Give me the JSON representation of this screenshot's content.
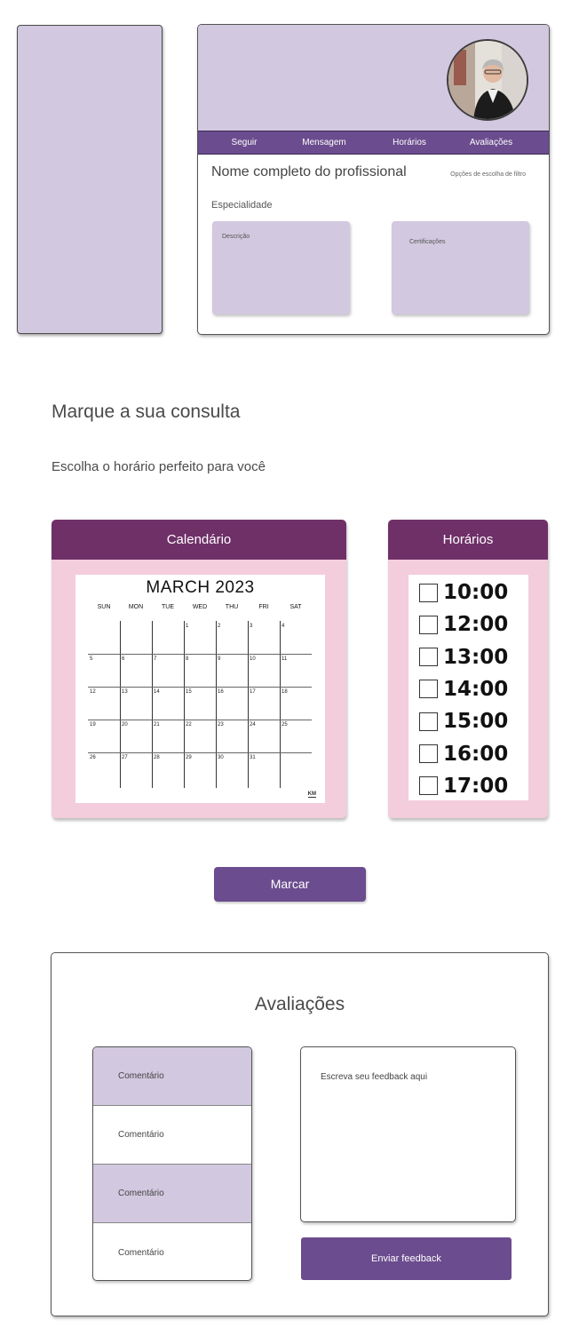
{
  "profile": {
    "nav": [
      "Seguir",
      "Mensagem",
      "Horários",
      "Avaliações"
    ],
    "name": "Nome completo do profissional",
    "filter_options": "Opções de escolha de filtro",
    "specialty": "Especialidade",
    "description_label": "Descrição",
    "certifications_label": "Certificações",
    "avatar_icon": "professional-portrait"
  },
  "booking": {
    "title": "Marque a sua consulta",
    "subtitle": "Escolha o horário perfeito para você",
    "calendar_header": "Calendário",
    "times_header": "Horários",
    "submit_label": "Marcar"
  },
  "calendar": {
    "title": "MARCH 2023",
    "weekdays": [
      "SUN",
      "MON",
      "TUE",
      "WED",
      "THU",
      "FRI",
      "SAT"
    ],
    "weeks": [
      [
        "",
        "",
        "",
        "1",
        "2",
        "3",
        "4"
      ],
      [
        "5",
        "6",
        "7",
        "8",
        "9",
        "10",
        "11"
      ],
      [
        "12",
        "13",
        "14",
        "15",
        "16",
        "17",
        "18"
      ],
      [
        "19",
        "20",
        "21",
        "22",
        "23",
        "24",
        "25"
      ],
      [
        "26",
        "27",
        "28",
        "29",
        "30",
        "31",
        ""
      ]
    ],
    "logo": "KM"
  },
  "times": [
    "10:00",
    "12:00",
    "13:00",
    "14:00",
    "15:00",
    "16:00",
    "17:00"
  ],
  "reviews": {
    "title": "Avaliações",
    "comments": [
      "Comentário",
      "Comentário",
      "Comentário",
      "Comentário"
    ],
    "feedback_placeholder": "Escreva seu feedback aqui",
    "send_label": "Enviar feedback"
  },
  "colors": {
    "lavender": "#d2c8df",
    "purple": "#6b4c8e",
    "plum": "#6f3068",
    "pink": "#f3cddb"
  }
}
